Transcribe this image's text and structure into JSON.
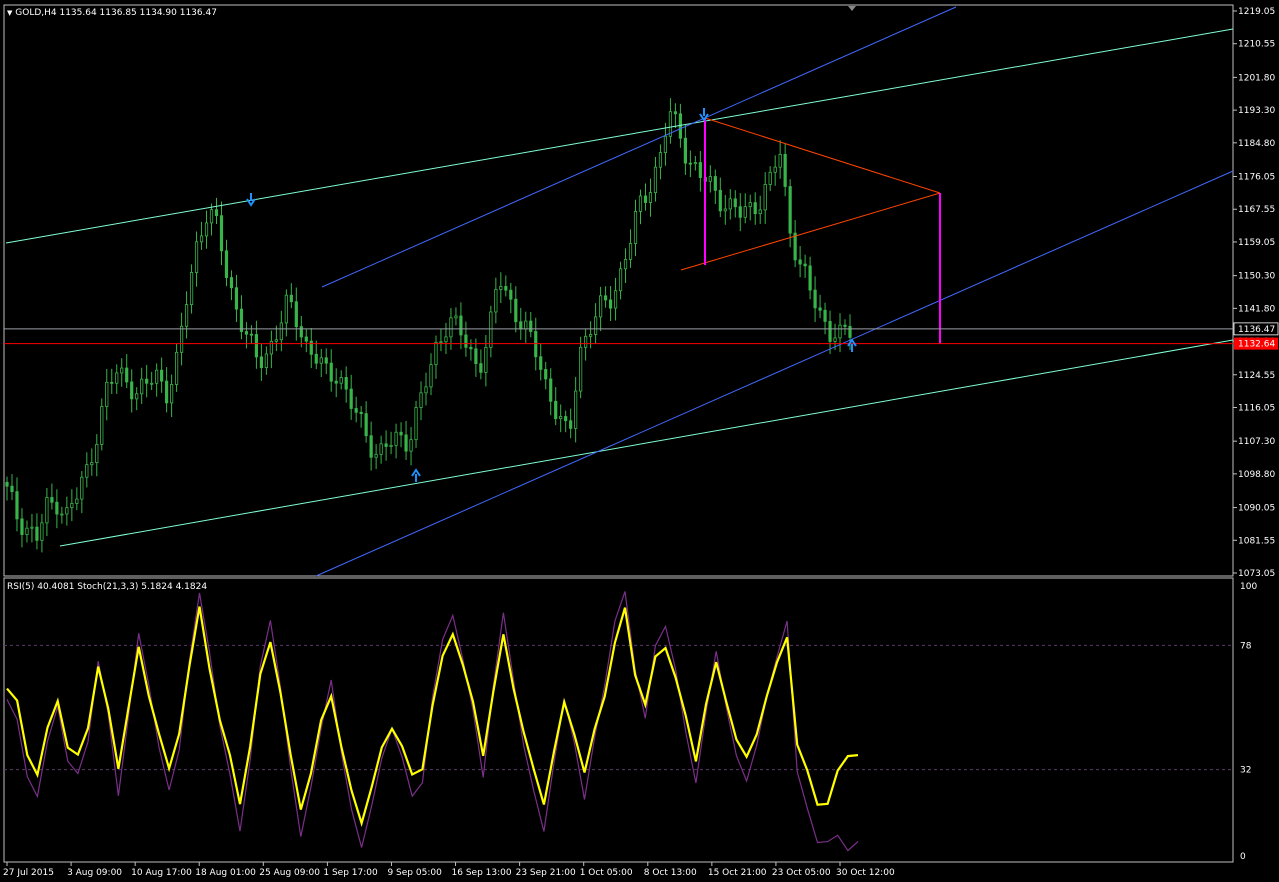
{
  "header": {
    "symbol_line": "GOLD,H4  1135.64 1136.85 1134.90 1136.47",
    "indicator_line": "RSI(5) 40.4081  Stoch(21,3,3) 5.1824 4.1824"
  },
  "colors": {
    "background": "#000000",
    "grid_border": "#c0c0c0",
    "candles": "#39b54a",
    "blue_channel": "#4169ff",
    "green_channel": "#7fffd4",
    "triangle": "#ff4500",
    "projection": "#ff00ff",
    "current_price_line": "#9aa0a6",
    "bid_line": "#ff0000",
    "arrows": "#1e90ff",
    "rsi": "#ffff00",
    "stoch": "#7b2f8a",
    "levels": "#5a3a6a"
  },
  "price_axis": {
    "ticks": [
      "1219.05",
      "1210.55",
      "1201.80",
      "1193.30",
      "1184.80",
      "1176.05",
      "1167.55",
      "1159.05",
      "1150.30",
      "1141.80",
      "1133.30",
      "1124.55",
      "1116.05",
      "1107.30",
      "1098.80",
      "1090.05",
      "1081.55",
      "1073.05"
    ],
    "current_price": "1136.47",
    "bid_price": "1132.64"
  },
  "indicator_axis": {
    "ticks": [
      "100",
      "78",
      "32",
      "0"
    ]
  },
  "time_axis": {
    "labels": [
      "27 Jul 2015",
      "3 Aug 09:00",
      "10 Aug 17:00",
      "18 Aug 01:00",
      "25 Aug 09:00",
      "1 Sep 17:00",
      "9 Sep 05:00",
      "16 Sep 13:00",
      "23 Sep 21:00",
      "1 Oct 05:00",
      "8 Oct 13:00",
      "15 Oct 21:00",
      "23 Oct 05:00",
      "30 Oct 12:00"
    ]
  },
  "chart_data": [
    {
      "type": "candlestick",
      "title": "GOLD,H4",
      "ylim": [
        1073.05,
        1219.05
      ],
      "x_labels": [
        "27 Jul 2015",
        "3 Aug 09:00",
        "10 Aug 17:00",
        "18 Aug 01:00",
        "25 Aug 09:00",
        "1 Sep 17:00",
        "9 Sep 05:00",
        "16 Sep 13:00",
        "23 Sep 21:00",
        "1 Oct 05:00",
        "8 Oct 13:00",
        "15 Oct 21:00",
        "23 Oct 05:00",
        "30 Oct 12:00"
      ],
      "close_path": [
        1094,
        1088,
        1085,
        1082,
        1090,
        1092,
        1088,
        1093,
        1100,
        1110,
        1121,
        1125,
        1124,
        1119,
        1122,
        1125,
        1120,
        1128,
        1146,
        1160,
        1167,
        1162,
        1150,
        1141,
        1133,
        1128,
        1131,
        1136,
        1143,
        1139,
        1131,
        1128,
        1124,
        1126,
        1118,
        1113,
        1108,
        1104,
        1106,
        1108,
        1108,
        1116,
        1124,
        1134,
        1139,
        1136,
        1131,
        1127,
        1134,
        1150,
        1145,
        1139,
        1134,
        1129,
        1120,
        1113,
        1107,
        1131,
        1136,
        1141,
        1144,
        1150,
        1158,
        1168,
        1174,
        1180,
        1192,
        1188,
        1180,
        1176,
        1174,
        1171,
        1168,
        1166,
        1168,
        1170,
        1174,
        1183,
        1163,
        1153,
        1146,
        1141,
        1136,
        1134,
        1136
      ],
      "last": {
        "open": 1135.64,
        "high": 1136.85,
        "low": 1134.9,
        "close": 1136.47
      },
      "horizontal_lines": [
        1136.47,
        1132.64
      ]
    },
    {
      "type": "line",
      "ylim": [
        0,
        100
      ],
      "levels": [
        78,
        32
      ],
      "series": [
        {
          "name": "RSI(5)",
          "last": 40.4081,
          "values": [
            62,
            55,
            40,
            30,
            45,
            60,
            40,
            35,
            50,
            70,
            52,
            35,
            55,
            75,
            62,
            45,
            30,
            48,
            70,
            90,
            72,
            50,
            35,
            22,
            40,
            65,
            82,
            60,
            35,
            20,
            30,
            48,
            62,
            40,
            22,
            15,
            25,
            38,
            50,
            40,
            28,
            35,
            55,
            72,
            85,
            70,
            55,
            40,
            60,
            80,
            65,
            45,
            30,
            22,
            38,
            55,
            48,
            30,
            45,
            62,
            78,
            90,
            70,
            55,
            72,
            80,
            65,
            50,
            38,
            55,
            70,
            60,
            42,
            35,
            48,
            58,
            70,
            84,
            40,
            30,
            22,
            18,
            30,
            40,
            36
          ]
        },
        {
          "name": "Stoch(21,3,3)",
          "last": 5.1824,
          "values": [
            58,
            48,
            32,
            22,
            40,
            58,
            35,
            28,
            45,
            72,
            50,
            25,
            52,
            80,
            66,
            40,
            22,
            42,
            72,
            95,
            78,
            48,
            28,
            12,
            35,
            68,
            90,
            62,
            30,
            10,
            25,
            45,
            68,
            38,
            15,
            6,
            18,
            34,
            50,
            36,
            20,
            30,
            58,
            78,
            92,
            72,
            52,
            32,
            62,
            88,
            68,
            40,
            22,
            12,
            34,
            56,
            45,
            20,
            42,
            66,
            86,
            96,
            72,
            50,
            76,
            88,
            68,
            44,
            30,
            52,
            74,
            58,
            36,
            26,
            44,
            58,
            72,
            90,
            30,
            16,
            8,
            4,
            6,
            5,
            4
          ]
        }
      ]
    }
  ]
}
